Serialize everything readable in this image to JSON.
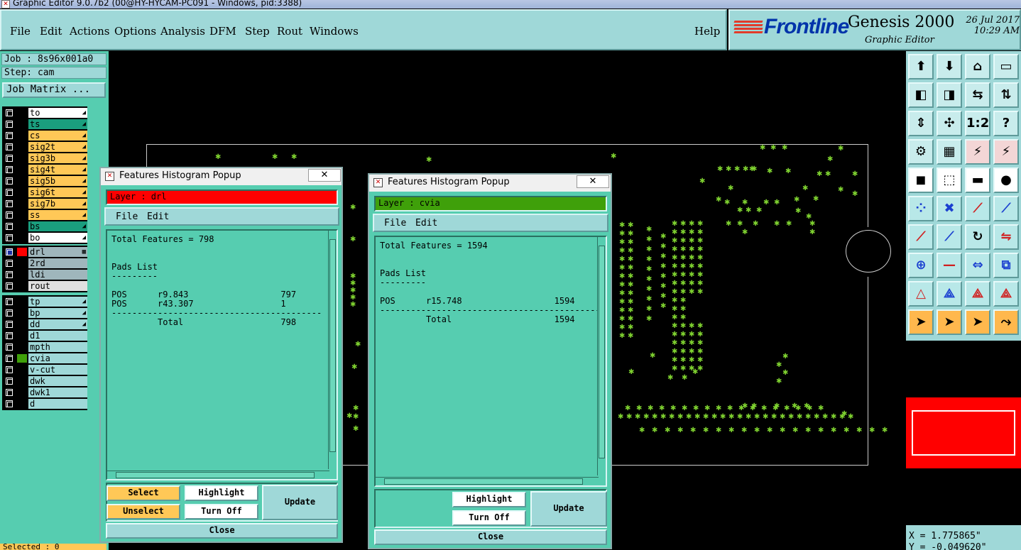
{
  "window": {
    "title": "Graphic Editor 9.0.7b2 (00@HY-HYCAM-PC091 - Windows, pid:3388)"
  },
  "menu": {
    "items": [
      "File",
      "Edit",
      "Actions",
      "Options",
      "Analysis",
      "DFM",
      "Step",
      "Rout",
      "Windows"
    ],
    "help": "Help"
  },
  "brand": {
    "logo": "Frontline",
    "product": "Genesis 2000",
    "subtitle": "Graphic Editor",
    "date": "26 Jul 2017",
    "time": "10:29 AM"
  },
  "left": {
    "job": "Job : 8s96x001a0",
    "step": "Step: cam",
    "job_matrix": "Job Matrix ...",
    "board_layers": [
      {
        "name": "to",
        "color": "#ffffff",
        "flag": "◢"
      },
      {
        "name": "ts",
        "color": "#1a9e7e",
        "flag": "◢"
      },
      {
        "name": "cs",
        "color": "#ffc857",
        "flag": "◢"
      },
      {
        "name": "sig2t",
        "color": "#ffc857",
        "flag": "◢"
      },
      {
        "name": "sig3b",
        "color": "#ffc857",
        "flag": "◢"
      },
      {
        "name": "sig4t",
        "color": "#ffc857",
        "flag": "◢"
      },
      {
        "name": "sig5b",
        "color": "#ffc857",
        "flag": "◢"
      },
      {
        "name": "sig6t",
        "color": "#ffc857",
        "flag": "◢"
      },
      {
        "name": "sig7b",
        "color": "#ffc857",
        "flag": "◢"
      },
      {
        "name": "ss",
        "color": "#ffc857",
        "flag": "◢"
      },
      {
        "name": "bs",
        "color": "#1a9e7e",
        "flag": "◢"
      },
      {
        "name": "bo",
        "color": "#ffffff",
        "flag": "◢"
      }
    ],
    "drill_layers": [
      {
        "name": "drl",
        "color": "#9fb6bc",
        "swatch": "#ff0000",
        "flag": "▦",
        "active": true
      },
      {
        "name": "2rd",
        "color": "#9fb6bc"
      },
      {
        "name": "ldi",
        "color": "#9fb6bc"
      },
      {
        "name": "rout",
        "color": "#e0e0e0"
      }
    ],
    "misc_layers": [
      {
        "name": "tp",
        "color": "#9fd8d8",
        "flag": "◢"
      },
      {
        "name": "bp",
        "color": "#9fd8d8",
        "flag": "◢"
      },
      {
        "name": "dd",
        "color": "#9fd8d8",
        "flag": "◢"
      },
      {
        "name": "d1",
        "color": "#9fd8d8"
      },
      {
        "name": "mpth",
        "color": "#9fd8d8"
      },
      {
        "name": "cvia",
        "color": "#9fd8d8",
        "swatch": "#3fa00a"
      },
      {
        "name": "v-cut",
        "color": "#9fd8d8"
      },
      {
        "name": "dwk",
        "color": "#9fd8d8"
      },
      {
        "name": "dwk1",
        "color": "#9fd8d8"
      },
      {
        "name": "d",
        "color": "#9fd8d8"
      }
    ]
  },
  "popup1": {
    "title": "Features Histogram Popup",
    "close_glyph": "✕",
    "layer": "Layer :  drl",
    "layer_color": "#ff0000",
    "menu_file": "File",
    "menu_edit": "Edit",
    "report": "Total Features = 798\n\n\nPads List\n---------\n\nPOS      r9.843                  797\nPOS      r43.307                 1\n-----------------------------------------\n         Total                   798",
    "select": "Select",
    "unselect": "Unselect",
    "highlight": "Highlight",
    "turn_off": "Turn Off",
    "update": "Update",
    "close": "Close"
  },
  "popup2": {
    "title": "Features Histogram Popup",
    "close_glyph": "✕",
    "layer": "Layer :  cvia",
    "layer_color": "#3fa00a",
    "menu_file": "File",
    "menu_edit": "Edit",
    "report": "Total Features = 1594\n\n\nPads List\n---------\n\nPOS      r15.748                  1594\n--------------------------------------------\n         Total                    1594",
    "highlight": "Highlight",
    "turn_off": "Turn Off",
    "update": "Update",
    "close": "Close"
  },
  "toolbar": {
    "icons": [
      "snapshot-icon",
      "zoom-home-icon",
      "house-icon",
      "fit-window-icon",
      "pan-left-icon",
      "pan-right-icon",
      "mirror-icon",
      "swap-icon",
      "zoom-fit-icon",
      "zoom-center-icon",
      "scale-1-2-icon",
      "help-icon",
      "measure-icon",
      "grid-icon",
      "net-highlight-icon",
      "net-compare-icon",
      "select-pad-icon",
      "select-box-icon",
      "ruler-icon",
      "select-dot-icon",
      "connect-nodes-icon",
      "cross-icon",
      "add-line-icon",
      "add-arc-pad-icon",
      "draw-line-icon",
      "draw-slanted-icon",
      "rotate-icon",
      "flip-icon",
      "add-feature-icon",
      "line-cut-icon",
      "move-box-icon",
      "copy-icon",
      "triangle-icon",
      "triangle-up-icon",
      "triangle-arrow-icon",
      "triangle-red-icon",
      "pointer-icon",
      "pointer-box-icon",
      "pointer-shield-icon",
      "route-icon"
    ],
    "scale_label": "1:2",
    "help_label": "?"
  },
  "status": {
    "x": "X = 1.775865\"",
    "y": "Y = -0.049620\"",
    "selected": "Selected : 0"
  }
}
